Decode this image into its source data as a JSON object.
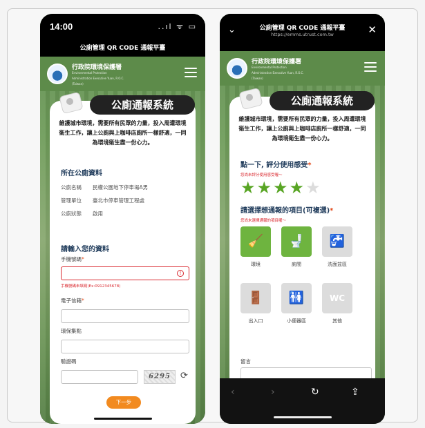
{
  "left": {
    "status_time": "14:00",
    "status_icons": "..ıl ᯤ ▭",
    "page_title": "公廁管理 QR CODE 通報平臺",
    "logo_cn": "行政院環境保護署",
    "logo_en": "Environmental Protection Administration Executive Yuan, R.O.C. (Taiwan)",
    "banner": "公廁通報系統",
    "intro": "維護城市環境，需要所有民眾的力量，投入周遭環境衛生工作，讓上公廁與上咖啡店廁所一樣舒適，一同為環境衛生盡一份心力。",
    "toilet_section_title": "所在公廁資料",
    "info": [
      {
        "k": "公廁名稱",
        "v": "民權公園地下停車場A男"
      },
      {
        "k": "管理單位",
        "v": "臺北市停車管理工程處"
      },
      {
        "k": "公廁狀態",
        "v": "啟用"
      }
    ],
    "form_title": "請輸入您的資料",
    "phone_label": "手機號碼",
    "phone_hint": "手機號碼未填寫(Ex:0912345678)",
    "email_label": "電子信箱",
    "points_label": "環保集點",
    "captcha_label": "驗證碼",
    "captcha_code": "6295",
    "next_button": "下一步",
    "required_mark": "*"
  },
  "right": {
    "title": "公廁管理 QR CODE 通報平臺",
    "url": "https://emms.utrust.com.tw",
    "close": "✕",
    "chevron": "⌄",
    "logo_cn": "行政院環境保護署",
    "logo_en": "Environmental Protection Administration Executive Yuan, R.O.C. (Taiwan)",
    "banner": "公廁通報系統",
    "intro": "維護城市環境，需要所有民眾的力量，投入周遭環境衛生工作，讓上公廁與上咖啡店廁所一樣舒適，一同為環境衛生盡一份心力。",
    "rating_title": "點一下, 評分使用感受",
    "rating_hint": "您尚未評分使用感受喔～",
    "rating_value": 4,
    "rating_max": 5,
    "items_title": "請選擇想通報的項目(可複選)",
    "items_hint": "您尚未選擇通報的項目喔～",
    "items": [
      {
        "label": "環境",
        "icon": "cleaning-icon",
        "selected": true
      },
      {
        "label": "廁間",
        "icon": "toilet-icon",
        "selected": true
      },
      {
        "label": "洗面盆區",
        "icon": "faucet-icon",
        "selected": false
      },
      {
        "label": "出入口",
        "icon": "door-icon",
        "selected": false
      },
      {
        "label": "小便器區",
        "icon": "urinal-icon",
        "selected": false
      },
      {
        "label": "其他",
        "icon": "wc-icon",
        "selected": false
      }
    ],
    "message_label": "留言",
    "required_mark": "*"
  },
  "colors": {
    "accent_orange": "#f28a1f",
    "accent_green": "#6eb43f",
    "error_red": "#d9262c"
  }
}
